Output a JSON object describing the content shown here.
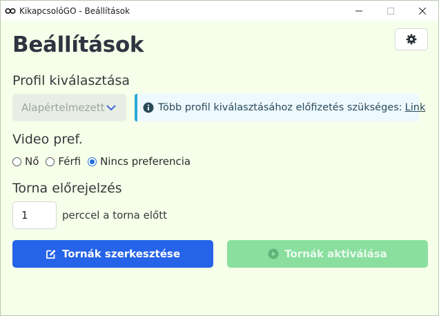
{
  "window": {
    "title": "KikapcsolóGO - Beállítások"
  },
  "header": {
    "title": "Beállítások",
    "settings_icon": "gear-icon"
  },
  "profile": {
    "label": "Profil kiválasztása",
    "select_value": "Alapértelmezett",
    "info_text": "Több profil kiválasztásához előfizetés szükséges:",
    "info_link": "Link",
    "info_color": "#2aa8d8"
  },
  "video": {
    "label": "Video pref.",
    "options": [
      {
        "label": "Nő",
        "checked": false
      },
      {
        "label": "Férfi",
        "checked": false
      },
      {
        "label": "Nincs preferencia",
        "checked": true
      }
    ]
  },
  "reminder": {
    "label": "Torna előrejelzés",
    "value": "1",
    "suffix": "perccel a torna előtt"
  },
  "actions": {
    "edit_label": "Tornák szerkesztése",
    "edit_color": "#2563e8",
    "activate_label": "Tornák aktiválása",
    "activate_color": "#8adf9e"
  }
}
